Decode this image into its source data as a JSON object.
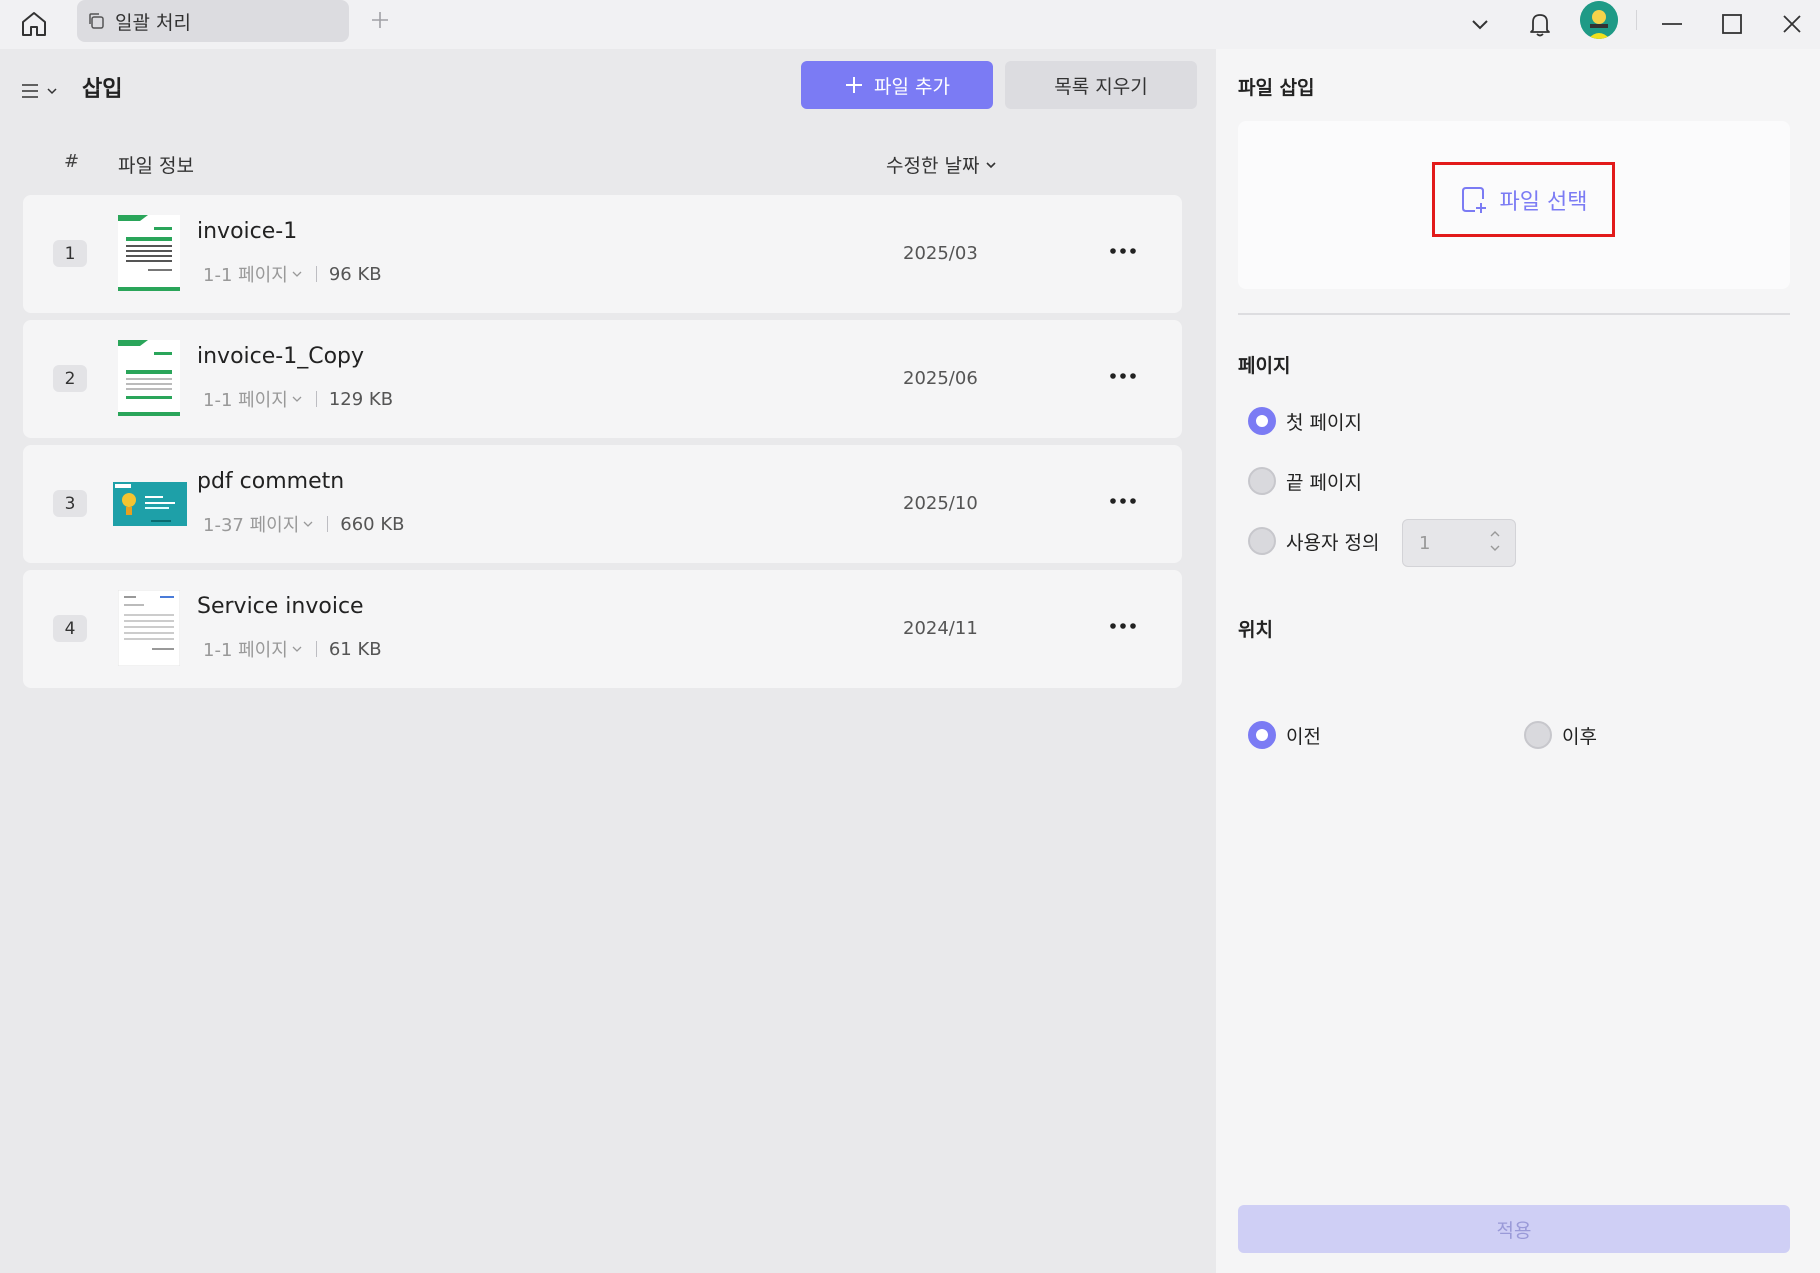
{
  "titlebar": {
    "tab_label": "일괄 처리"
  },
  "header": {
    "title": "삽입",
    "add_file_label": "파일 추가",
    "clear_list_label": "목록 지우기"
  },
  "table": {
    "col_num": "#",
    "col_info": "파일 정보",
    "col_date": "수정한 날짜"
  },
  "files": [
    {
      "num": "1",
      "name": "invoice-1",
      "pages": "1-1 페이지",
      "size": "96 KB",
      "date": "2025/03"
    },
    {
      "num": "2",
      "name": "invoice-1_Copy",
      "pages": "1-1 페이지",
      "size": "129 KB",
      "date": "2025/06"
    },
    {
      "num": "3",
      "name": "pdf commetn",
      "pages": "1-37 페이지",
      "size": "660 KB",
      "date": "2025/10"
    },
    {
      "num": "4",
      "name": "Service invoice",
      "pages": "1-1 페이지",
      "size": "61 KB",
      "date": "2024/11"
    }
  ],
  "right_panel": {
    "title": "파일 삽입",
    "select_file_label": "파일 선택",
    "page_section": "페이지",
    "page_options": [
      "첫 페이지",
      "끝 페이지",
      "사용자 정의"
    ],
    "page_selected": "첫 페이지",
    "custom_value": "1",
    "position_section": "위치",
    "position_options": [
      "이전",
      "이후"
    ],
    "position_selected": "이전",
    "apply_label": "적용"
  },
  "colors": {
    "accent": "#7b7bf4",
    "highlight_border": "#e21a1a",
    "invoice_green": "#2aa55a",
    "pdf_teal": "#1ea0a8"
  },
  "icons": [
    "home-icon",
    "copy-icon",
    "plus-icon",
    "chevron-down-icon",
    "bell-icon",
    "avatar",
    "minimize-icon",
    "maximize-icon",
    "close-icon",
    "menu-icon",
    "more-icon",
    "file-add-icon"
  ]
}
